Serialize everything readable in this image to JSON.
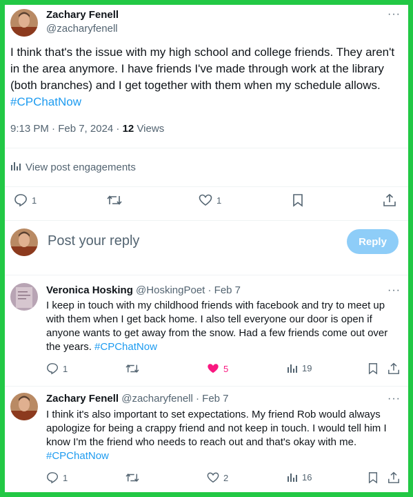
{
  "main_post": {
    "author_name": "Zachary Fenell",
    "author_handle": "@zacharyfenell",
    "text": "I think that's the issue with my high school and college friends. They aren't in the area anymore. I have friends I've made through work at the library (both branches) and I get together with them when my schedule allows.",
    "hashtag": "#CPChatNow",
    "timestamp": "9:13 PM · Feb 7, 2024 · ",
    "views_count": "12",
    "views_label": "Views",
    "engagements_label": "View post engagements",
    "reply_count": "1",
    "like_count": "1",
    "more_label": "···"
  },
  "compose": {
    "placeholder": "Post your reply",
    "reply_button": "Reply"
  },
  "replies": [
    {
      "author_name": "Veronica Hosking",
      "author_handle": "@HoskingPoet",
      "date": "· Feb 7",
      "text": "I keep in touch with my childhood friends with facebook and try to meet up with them when I get back home. I also tell everyone our door is open if anyone wants to get away from the snow. Had a few friends come out over the years.",
      "hashtag": "#CPChatNow",
      "reply_count": "1",
      "like_count": "5",
      "views_count": "19",
      "more_label": "···"
    },
    {
      "author_name": "Zachary Fenell",
      "author_handle": "@zacharyfenell",
      "date": "· Feb 7",
      "text": "I think it's also important to set expectations. My friend Rob would always apologize for being a crappy friend and not keep in touch. I would tell him I know I'm the friend who needs to reach out and that's okay with me.",
      "hashtag": "#CPChatNow",
      "reply_count": "1",
      "like_count": "2",
      "views_count": "16",
      "more_label": "···"
    }
  ],
  "colors": {
    "border": "#22c845",
    "accent": "#1d9bf0",
    "like_active": "#f91880",
    "muted": "#536471",
    "reply_button_bg": "#8ecdf8"
  }
}
